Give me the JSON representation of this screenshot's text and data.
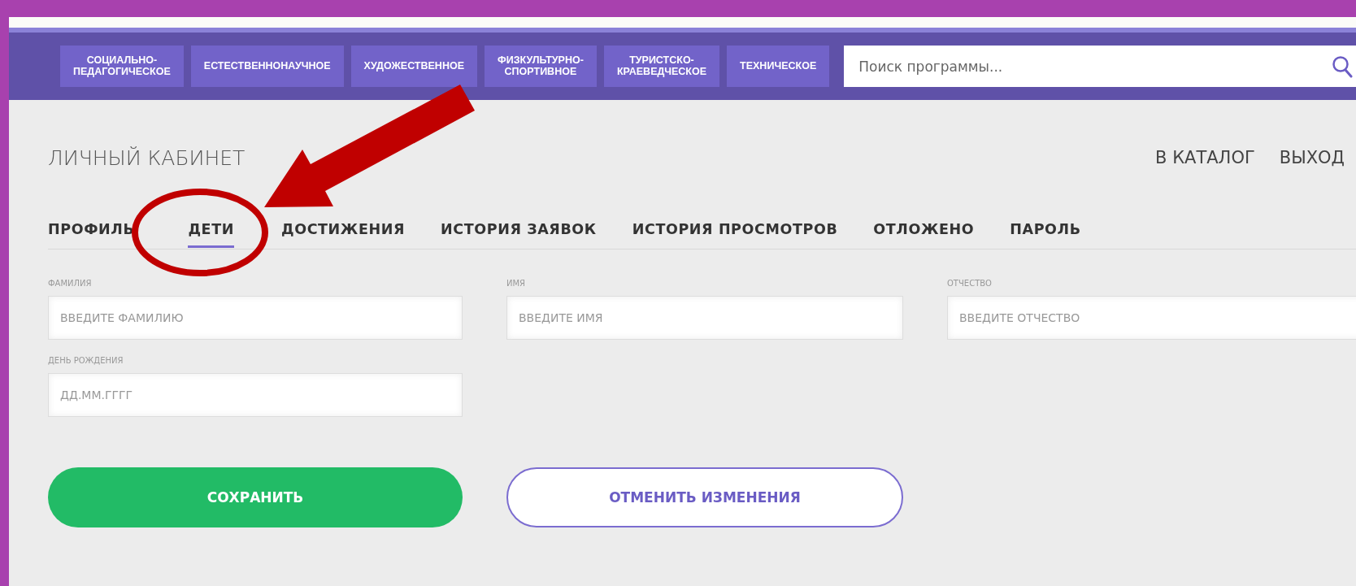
{
  "categories": [
    {
      "label": "СОЦИАЛЬНО-\nПЕДАГОГИЧЕСКОЕ"
    },
    {
      "label": "ЕСТЕСТВЕННОНАУЧНОЕ"
    },
    {
      "label": "ХУДОЖЕСТВЕННОЕ"
    },
    {
      "label": "ФИЗКУЛЬТУРНО-\nСПОРТИВНОЕ"
    },
    {
      "label": "ТУРИСТСКО-\nКРАЕВЕДЧЕСКОЕ"
    },
    {
      "label": "ТЕХНИЧЕСКОЕ"
    }
  ],
  "search": {
    "placeholder": "Поиск программы..."
  },
  "page_title": "ЛИЧНЫЙ КАБИНЕТ",
  "header_links": [
    "В КАТАЛОГ",
    "ВЫХОД"
  ],
  "tabs": [
    {
      "label": "ПРОФИЛЬ",
      "selected": false
    },
    {
      "label": "ДЕТИ",
      "selected": true
    },
    {
      "label": "ДОСТИЖЕНИЯ",
      "selected": false
    },
    {
      "label": "ИСТОРИЯ ЗАЯВОК",
      "selected": false
    },
    {
      "label": "ИСТОРИЯ ПРОСМОТРОВ",
      "selected": false
    },
    {
      "label": "ОТЛОЖЕНО",
      "selected": false
    },
    {
      "label": "ПАРОЛЬ",
      "selected": false
    }
  ],
  "fields": [
    {
      "label": "ФАМИЛИЯ",
      "placeholder": "ВВЕДИТЕ ФАМИЛИЮ"
    },
    {
      "label": "ИМЯ",
      "placeholder": "ВВЕДИТЕ ИМЯ"
    },
    {
      "label": "ОТЧЕСТВО",
      "placeholder": "ВВЕДИТЕ ОТЧЕСТВО"
    },
    {
      "label": "ДЕНЬ РОЖДЕНИЯ",
      "placeholder": "ДД.ММ.ГГГГ"
    }
  ],
  "buttons": [
    {
      "label": "СОХРАНИТЬ",
      "kind": "primary"
    },
    {
      "label": "ОТМЕНИТЬ ИЗМЕНЕНИЯ",
      "kind": "outline"
    }
  ]
}
